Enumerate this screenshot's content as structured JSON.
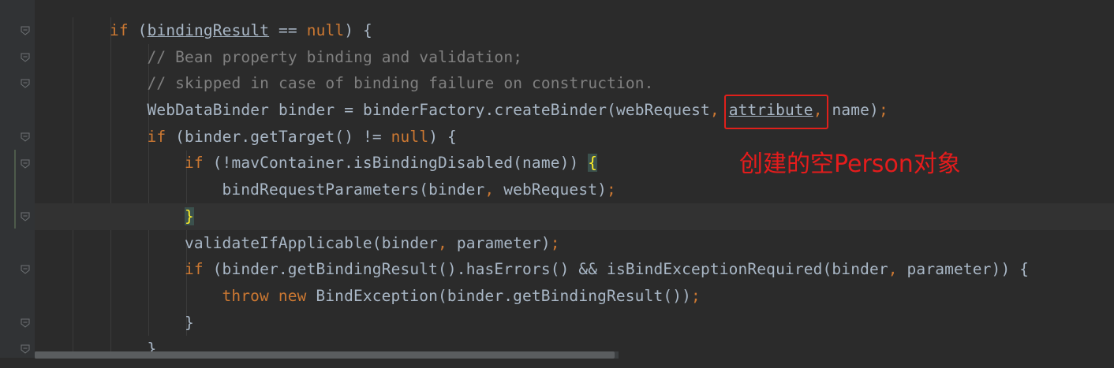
{
  "editor": {
    "lines": [
      {
        "indent": 2,
        "tokens": [
          {
            "t": "if",
            "c": "kw"
          },
          {
            "t": " ("
          },
          {
            "t": "bindingResult",
            "c": "ul"
          },
          {
            "t": " == "
          },
          {
            "t": "null",
            "c": "kw"
          },
          {
            "t": ") {"
          }
        ]
      },
      {
        "indent": 3,
        "tokens": [
          {
            "t": "// Bean property binding and validation;",
            "c": "cm"
          }
        ]
      },
      {
        "indent": 3,
        "tokens": [
          {
            "t": "// skipped in case of binding failure on construction.",
            "c": "cm"
          }
        ]
      },
      {
        "indent": 3,
        "tokens": [
          {
            "t": "WebDataBinder binder = binderFactory.createBinder(webRequest"
          },
          {
            "t": ", ",
            "c": "punct"
          },
          {
            "t": "attribute",
            "c": "ul"
          },
          {
            "t": ", ",
            "c": "punct"
          },
          {
            "t": "name)"
          },
          {
            "t": ";",
            "c": "punct"
          }
        ]
      },
      {
        "indent": 3,
        "tokens": [
          {
            "t": "if",
            "c": "kw"
          },
          {
            "t": " (binder.getTarget() != "
          },
          {
            "t": "null",
            "c": "kw"
          },
          {
            "t": ") {"
          }
        ]
      },
      {
        "indent": 4,
        "tokens": [
          {
            "t": "if",
            "c": "kw"
          },
          {
            "t": " (!mavContainer.isBindingDisabled(name)) "
          },
          {
            "t": "{",
            "c": "brace-hl"
          }
        ]
      },
      {
        "indent": 5,
        "tokens": [
          {
            "t": "bindRequestParameters(binder"
          },
          {
            "t": ", ",
            "c": "punct"
          },
          {
            "t": "webRequest)"
          },
          {
            "t": ";",
            "c": "punct"
          }
        ]
      },
      {
        "indent": 4,
        "current": true,
        "tokens": [
          {
            "t": "}",
            "c": "brace-hl"
          }
        ]
      },
      {
        "indent": 4,
        "tokens": [
          {
            "t": "validateIfApplicable(binder"
          },
          {
            "t": ", ",
            "c": "punct"
          },
          {
            "t": "parameter)"
          },
          {
            "t": ";",
            "c": "punct"
          }
        ]
      },
      {
        "indent": 4,
        "tokens": [
          {
            "t": "if",
            "c": "kw"
          },
          {
            "t": " (binder.getBindingResult().hasErrors() && isBindExceptionRequired(binder"
          },
          {
            "t": ", ",
            "c": "punct"
          },
          {
            "t": "parameter)) {"
          }
        ]
      },
      {
        "indent": 5,
        "tokens": [
          {
            "t": "throw new",
            "c": "kw"
          },
          {
            "t": " BindException(binder.getBindingResult())"
          },
          {
            "t": ";",
            "c": "punct"
          }
        ]
      },
      {
        "indent": 4,
        "tokens": [
          {
            "t": "}"
          }
        ]
      },
      {
        "indent": 3,
        "tokens": [
          {
            "t": "}"
          }
        ]
      }
    ]
  },
  "annotation": {
    "text": "创建的空Person对象",
    "color": "#e51c1c"
  },
  "colors": {
    "background": "#2b2b2b",
    "keyword": "#cc7832",
    "comment": "#808080",
    "text": "#a9b7c6"
  }
}
